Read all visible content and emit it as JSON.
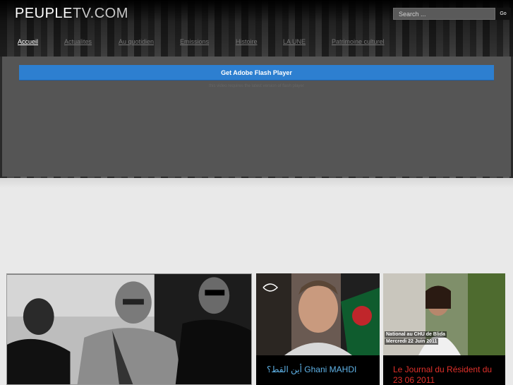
{
  "header": {
    "logo_bold": "PEUPLE",
    "logo_light": "TV.COM"
  },
  "search": {
    "placeholder": "Search ...",
    "go_label": "Go"
  },
  "nav": {
    "items": [
      {
        "label": "Accueil",
        "active": true
      },
      {
        "label": "Actualites",
        "active": false
      },
      {
        "label": "Au quotidien",
        "active": false
      },
      {
        "label": "Emissions",
        "active": false
      },
      {
        "label": "Histoire",
        "active": false
      },
      {
        "label": "LA UNE",
        "active": false
      },
      {
        "label": "Patrimoine culturel",
        "active": false
      }
    ]
  },
  "player": {
    "flash_button": "Get Adobe Flash Player",
    "flash_note": "this video requires the latest version of flash player"
  },
  "cards": [
    {
      "caption": ""
    },
    {
      "caption": "أين القط؟ Ghani MAHDI",
      "overlay": ""
    },
    {
      "caption": "Le Journal du Résident du 23 06 2011",
      "overlay_line1": "National au CHU de Blida",
      "overlay_line2": "Mercredi 22 Juin 2011"
    }
  ],
  "colors": {
    "flash_blue": "#2d7fd0",
    "caption_blue": "#5fb3e8",
    "caption_red": "#e0302a"
  }
}
